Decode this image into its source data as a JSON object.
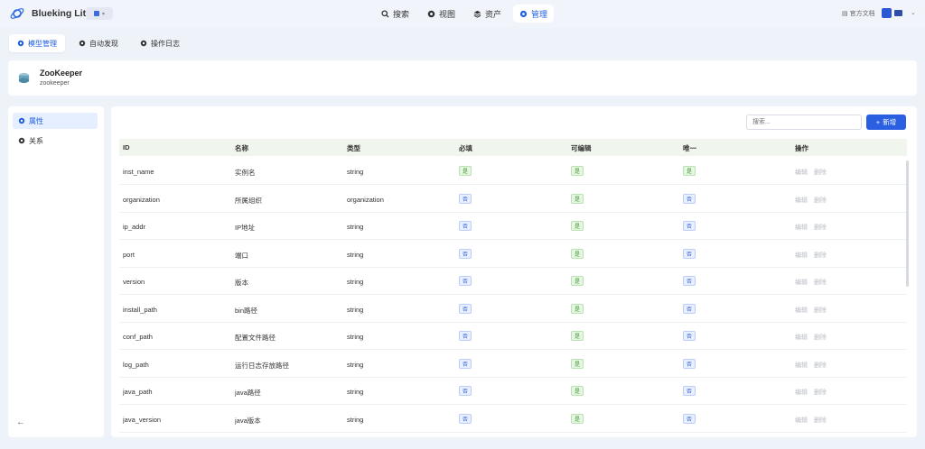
{
  "app": {
    "name": "Blueking Lite"
  },
  "nav": {
    "items": [
      {
        "label": "搜索",
        "icon": "search-icon",
        "active": false
      },
      {
        "label": "视图",
        "icon": "view-icon",
        "active": false
      },
      {
        "label": "资产",
        "icon": "asset-icon",
        "active": false
      },
      {
        "label": "管理",
        "icon": "manage-icon",
        "active": true
      }
    ]
  },
  "header": {
    "docs_label": "官方文档"
  },
  "subtabs": [
    {
      "label": "模型管理",
      "active": true
    },
    {
      "label": "自动发现",
      "active": false
    },
    {
      "label": "操作日志",
      "active": false
    }
  ],
  "model": {
    "name": "ZooKeeper",
    "id": "zookeeper"
  },
  "sidebar": {
    "items": [
      {
        "label": "属性",
        "active": true
      },
      {
        "label": "关系",
        "active": false
      }
    ]
  },
  "toolbar": {
    "search_placeholder": "搜索...",
    "add_label": "新增"
  },
  "table": {
    "columns": [
      "ID",
      "名称",
      "类型",
      "必填",
      "可编辑",
      "唯一",
      "操作"
    ],
    "yes": "是",
    "no": "否",
    "edit_label": "编辑",
    "delete_label": "删除",
    "rows": [
      {
        "id": "inst_name",
        "name": "实例名",
        "type": "string",
        "required": "是",
        "editable": "是",
        "unique": "是"
      },
      {
        "id": "organization",
        "name": "所属组织",
        "type": "organization",
        "required": "否",
        "editable": "是",
        "unique": "否"
      },
      {
        "id": "ip_addr",
        "name": "IP地址",
        "type": "string",
        "required": "否",
        "editable": "是",
        "unique": "否"
      },
      {
        "id": "port",
        "name": "端口",
        "type": "string",
        "required": "否",
        "editable": "是",
        "unique": "否"
      },
      {
        "id": "version",
        "name": "版本",
        "type": "string",
        "required": "否",
        "editable": "是",
        "unique": "否"
      },
      {
        "id": "install_path",
        "name": "bin路径",
        "type": "string",
        "required": "否",
        "editable": "是",
        "unique": "否"
      },
      {
        "id": "conf_path",
        "name": "配置文件路径",
        "type": "string",
        "required": "否",
        "editable": "是",
        "unique": "否"
      },
      {
        "id": "log_path",
        "name": "运行日志存放路径",
        "type": "string",
        "required": "否",
        "editable": "是",
        "unique": "否"
      },
      {
        "id": "java_path",
        "name": "java路径",
        "type": "string",
        "required": "否",
        "editable": "是",
        "unique": "否"
      },
      {
        "id": "java_version",
        "name": "java版本",
        "type": "string",
        "required": "否",
        "editable": "是",
        "unique": "否"
      }
    ]
  },
  "colors": {
    "accent": "#2a5fe2",
    "yes_tag": "#3d9a2d",
    "no_tag": "#3b66d8"
  }
}
